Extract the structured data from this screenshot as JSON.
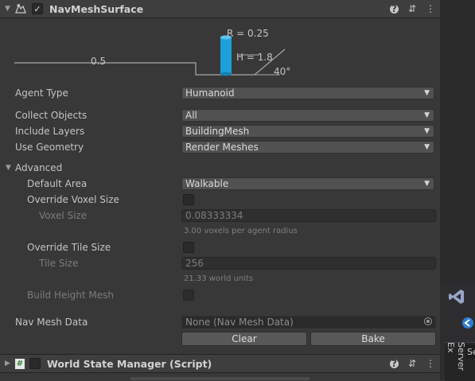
{
  "component": {
    "title": "NavMeshSurface",
    "enabled": true,
    "diagram": {
      "radius_label": "R = 0.25",
      "height_label": "H = 1.8",
      "step_label": "0.5",
      "slope_label": "40°"
    }
  },
  "fields": {
    "agent_type": {
      "label": "Agent Type",
      "value": "Humanoid"
    },
    "collect_objects": {
      "label": "Collect Objects",
      "value": "All"
    },
    "include_layers": {
      "label": "Include Layers",
      "value": "BuildingMesh"
    },
    "use_geometry": {
      "label": "Use Geometry",
      "value": "Render Meshes"
    }
  },
  "advanced": {
    "label": "Advanced",
    "default_area": {
      "label": "Default Area",
      "value": "Walkable"
    },
    "override_voxel_size": {
      "label": "Override Voxel Size",
      "checked": false
    },
    "voxel_size": {
      "label": "Voxel Size",
      "value": "0.08333334",
      "hint": "3.00 voxels per agent radius"
    },
    "override_tile_size": {
      "label": "Override Tile Size",
      "checked": false
    },
    "tile_size": {
      "label": "Tile Size",
      "value": "256",
      "hint": "21.33 world units"
    },
    "build_height_mesh": {
      "label": "Build Height Mesh",
      "checked": false
    }
  },
  "nav_mesh_data": {
    "label": "Nav Mesh Data",
    "value": "None (Nav Mesh Data)"
  },
  "buttons": {
    "clear": "Clear",
    "bake": "Bake"
  },
  "next_component": {
    "title": "World State Manager (Script)",
    "enabled": false
  },
  "side_panel": {
    "vertical_label": "Server Ex",
    "tab_label": "Se"
  },
  "colors": {
    "agent_cylinder": "#1e9fd8",
    "panel_bg": "#383838"
  }
}
